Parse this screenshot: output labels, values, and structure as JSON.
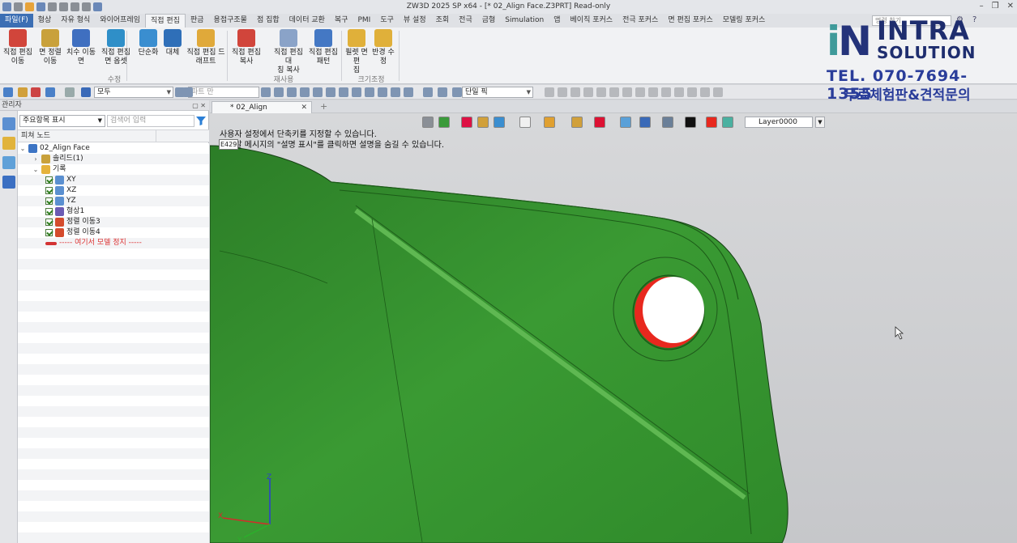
{
  "window": {
    "title": "ZW3D 2025 SP x64 - [* 02_Align Face.Z3PRT] Read-only",
    "controls": [
      "–",
      "❐",
      "✕"
    ]
  },
  "menu": {
    "file": "파일(F)",
    "tabs": [
      "형상",
      "자유 형식",
      "와이어프레임",
      "직접 편집",
      "판금",
      "용접구조물",
      "점 집합",
      "데이터 교환",
      "복구",
      "PMI",
      "도구",
      "뷰 설정",
      "조회",
      "전극",
      "금형",
      "Simulation",
      "앱",
      "베이직 포커스",
      "전극 포커스",
      "면 편집 포커스",
      "모델링 포커스"
    ],
    "active": "직접 편집",
    "search_placeholder": "명령 찾기"
  },
  "ribbon": {
    "buttons": [
      {
        "l1": "직접 편집",
        "l2": "이동"
      },
      {
        "l1": "면 정렬",
        "l2": "이동"
      },
      {
        "l1": "치수 이동",
        "l2": "면"
      },
      {
        "l1": "직접 편집",
        "l2": "면 옵셋"
      },
      {
        "l1": "단순화",
        "l2": ""
      },
      {
        "l1": "대체",
        "l2": ""
      },
      {
        "l1": "직접 편집 드",
        "l2": "래프트"
      },
      {
        "l1": "직접 편집",
        "l2": "복사"
      },
      {
        "l1": "직접 편집 대",
        "l2": "칭 복사"
      },
      {
        "l1": "직접 편집",
        "l2": "패턴"
      },
      {
        "l1": "필렛 면 편",
        "l2": "집"
      },
      {
        "l1": "반경 수",
        "l2": "정"
      }
    ],
    "groups": [
      "수정",
      "재사용",
      "크기조정"
    ]
  },
  "toolbar": {
    "filter_value": "모두",
    "part_placeholder": "파트 만",
    "pick_mode": "단일 픽"
  },
  "manager": {
    "title": "관리자",
    "display_mode": "주요항목 표시",
    "search_placeholder": "검색어 입력",
    "column_header": "피쳐 노드",
    "tree": [
      {
        "label": "02_Align Face",
        "level": 0,
        "expander": "v",
        "icon": "part-icon",
        "color": "#3c74c4",
        "check": false
      },
      {
        "label": "솔리드(1)",
        "level": 1,
        "expander": ">",
        "icon": "solid-icon",
        "color": "#c9a13b",
        "check": false
      },
      {
        "label": "기록",
        "level": 1,
        "expander": "v",
        "icon": "folder-icon",
        "color": "#e5b23b",
        "check": false
      },
      {
        "label": "XY",
        "level": 2,
        "expander": "",
        "icon": "plane-icon",
        "color": "#5a8fd0",
        "check": true
      },
      {
        "label": "XZ",
        "level": 2,
        "expander": "",
        "icon": "plane-icon",
        "color": "#5a8fd0",
        "check": true
      },
      {
        "label": "YZ",
        "level": 2,
        "expander": "",
        "icon": "plane-icon",
        "color": "#5a8fd0",
        "check": true
      },
      {
        "label": "형상1",
        "level": 2,
        "expander": "",
        "icon": "shape-icon",
        "color": "#6b5bb3",
        "check": true
      },
      {
        "label": "정렬 이동3",
        "level": 2,
        "expander": "",
        "icon": "align-move-icon",
        "color": "#d44b2c",
        "check": true
      },
      {
        "label": "정렬 이동4",
        "level": 2,
        "expander": "",
        "icon": "align-move-icon",
        "color": "#d44b2c",
        "check": true
      },
      {
        "label": "----- 여기서 모델 정지 -----",
        "level": 2,
        "expander": "",
        "icon": "stop-arrow-icon",
        "color": "#d33333",
        "check": false
      }
    ]
  },
  "document": {
    "tab_label": "* 02_Align Face.Z3PRT",
    "close": "✕",
    "add": "+"
  },
  "viewport": {
    "layer": "Layer0000",
    "hint_line1": "사용자 설정에서 단축키를 지정할 수 있습니다.",
    "hint_line2": "도움말 메시지의 \"설명 표시\"를 클릭하면 설명을 숨길 수 있습니다.",
    "code": "E429",
    "axis_labels": [
      "X",
      "Y",
      "Z"
    ],
    "part_color": "#2f8a2a",
    "hole_color": "#e8281e"
  },
  "watermark": {
    "mark_i": "i",
    "mark_n": "N",
    "brand_line1": "INTRA",
    "brand_line2": "SOLUTION",
    "tel": "TEL. 070-7694-1355",
    "ad": "무료체험판&견적문의"
  }
}
